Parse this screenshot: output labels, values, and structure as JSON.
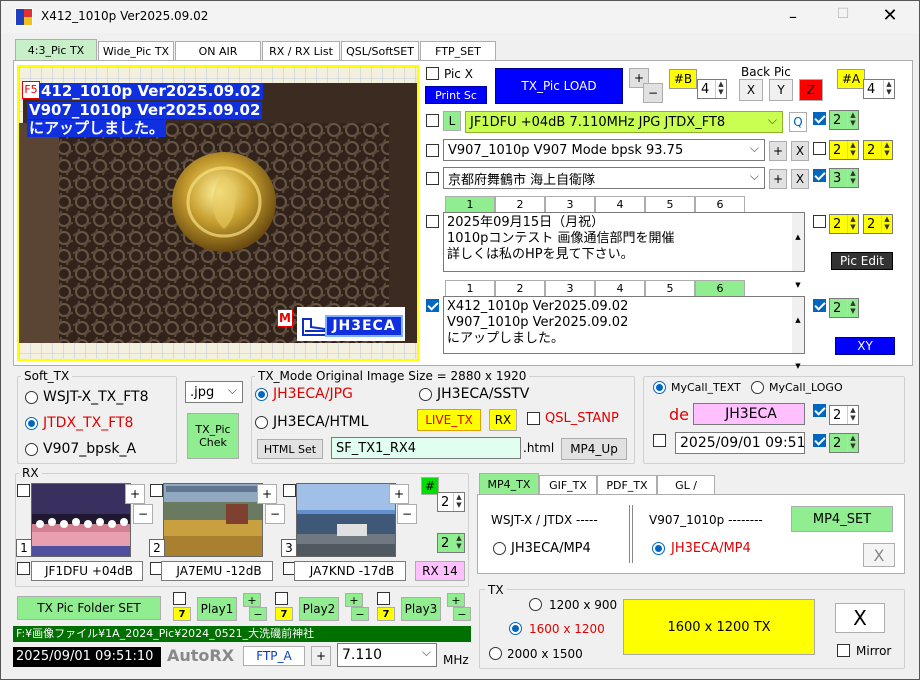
{
  "window": {
    "title": "X412_1010p    Ver2025.09.02"
  },
  "main_tabs": [
    {
      "label": "4:3_Pic TX",
      "selected": true
    },
    {
      "label": "Wide_Pic TX",
      "selected": false
    },
    {
      "label": "ON AIR",
      "selected": false
    },
    {
      "label": "RX / RX List",
      "selected": false
    },
    {
      "label": "QSL/SoftSET",
      "selected": false
    },
    {
      "label": "FTP_SET",
      "selected": false
    }
  ],
  "preview": {
    "f5": "F5",
    "overlay_lines": [
      "412_1010p  Ver2025.09.02",
      "V907_1010p  Ver2025.09.02",
      "にアップしました。"
    ],
    "m_label": "M",
    "callsign_logo": "JH3ECA"
  },
  "pic_controls": {
    "pic_x": "Pic X",
    "print_sc": "Print Sc",
    "tx_pic_load": "TX_Pic  LOAD",
    "plus": "+",
    "minus": "−",
    "b_badge": "#B",
    "b_value": "4",
    "back_pic": "Back Pic",
    "x": "X",
    "y": "Y",
    "z": "Z",
    "a_badge": "#A",
    "a_value": "4"
  },
  "line1": {
    "l": "L",
    "text": "JF1DFU +04dB  7.110MHz  JPG  JTDX_FT8",
    "q": "Q",
    "spin": "2"
  },
  "line2": {
    "text": "V907_1010p  V907 Mode  bpsk  93.75",
    "plus": "+",
    "x": "X",
    "spin_a": "2",
    "spin_b": "2"
  },
  "line3": {
    "text": "京都府舞鶴市  海上自衛隊",
    "plus": "+",
    "x": "X",
    "spin": "3"
  },
  "memo_tabs": [
    "1",
    "2",
    "3",
    "4",
    "5",
    "6"
  ],
  "memo1": {
    "lines": [
      "2025年09月15日（月祝）",
      "1010pコンテスト 画像通信部門を開催",
      "詳しくは私のHPを見て下さい。"
    ],
    "spin_a": "2",
    "spin_b": "2",
    "pic_edit": "Pic  Edit"
  },
  "memo2": {
    "lines": [
      "X412_1010p  Ver2025.09.02",
      "V907_1010p  Ver2025.09.02",
      "にアップしました。"
    ],
    "spin": "2",
    "xy": "XY"
  },
  "soft_tx": {
    "title": "Soft_TX",
    "options": [
      "WSJT-X_TX_FT8",
      "JTDX_TX_FT8",
      "V907_bpsk_A"
    ],
    "format": ".jpg",
    "tx_pic_chek": "TX_Pic\nChek"
  },
  "tx_mode": {
    "title": "TX_Mode   Original  Image  Size = 2880 x 1920",
    "jpg": "JH3ECA/JPG",
    "sstv": "JH3ECA/SSTV",
    "html": "JH3ECA/HTML",
    "live_tx": "LIVE_TX",
    "rx": "RX",
    "qsl_stamp": "QSL_STANP",
    "html_set": "HTML Set",
    "file": "SF_TX1_RX4",
    "ext": ".html",
    "mp4_up": "MP4_Up"
  },
  "mycall": {
    "text_opt": "MyCall_TEXT",
    "logo_opt": "MyCall_LOGO",
    "de": "de",
    "call": "JH3ECA",
    "spin_a": "2",
    "datetime": "2025/09/01  09:51",
    "spin_b": "2"
  },
  "rx": {
    "title": "RX",
    "items": [
      {
        "index": "1",
        "label": "JF1DFU  +04dB"
      },
      {
        "index": "2",
        "label": "JA7EMU  -12dB"
      },
      {
        "index": "3",
        "label": "JA7KND  -17dB"
      }
    ],
    "hash": "#",
    "spin_a": "2",
    "spin_b": "2",
    "rx14": "RX 14",
    "plus": "+",
    "minus": "−"
  },
  "folder": {
    "set": "TX Pic  Folder SET",
    "path": "F:¥画像ファイル¥1A_2024_Pic¥2024_0521_大洗磯前神社",
    "plays": [
      {
        "num": "7",
        "label": "Play1"
      },
      {
        "num": "7",
        "label": "Play2"
      },
      {
        "num": "7",
        "label": "Play3"
      }
    ]
  },
  "status": {
    "datetime": "2025/09/01    09:51:10",
    "autorx": "AutoRX",
    "ftp": "FTP_A",
    "plus": "+",
    "freq": "7.110",
    "unit": "MHz"
  },
  "mp4_panel": {
    "tabs": [
      "MP4_TX",
      "GIF_TX",
      "PDF_TX",
      "GL /"
    ],
    "wsjt_title": "WSJT-X / JTDX  -----",
    "v907_title": "V907_1010p  --------",
    "mp4_set": "MP4_SET",
    "opt_left": "JH3ECA/MP4",
    "opt_right": "JH3ECA/MP4",
    "x": "X"
  },
  "tx_panel": {
    "title": "TX",
    "sizes": [
      "1200 x 900",
      "1600 x 1200",
      "2000 x 1500"
    ],
    "tx_button": "1600 x 1200    TX",
    "x": "X",
    "mirror": "Mirror"
  },
  "colors": {
    "yellow": "#ffff00",
    "green_btn": "#90ee90",
    "blue_btn": "#0000ff",
    "pink": "#ffc0ff",
    "red": "#e00000"
  }
}
